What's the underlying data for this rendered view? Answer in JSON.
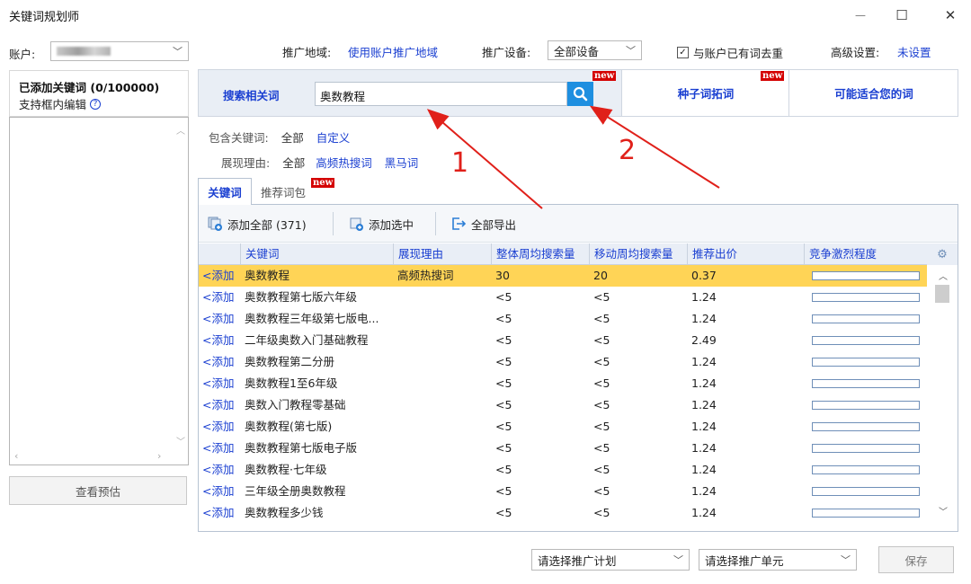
{
  "window": {
    "title": "关键词规划师",
    "minimize_glyph": "—",
    "maximize_glyph": "☐",
    "close_glyph": "✕"
  },
  "top_settings": {
    "account_label": "账户:",
    "region_label": "推广地域:",
    "region_value": "使用账户推广地域",
    "device_label": "推广设备:",
    "device_value": "全部设备",
    "dedupe_label": "与账户已有词去重",
    "dedupe_checked": true,
    "advanced_label": "高级设置:",
    "advanced_value": "未设置"
  },
  "left_pane": {
    "header_title": "已添加关键词 (0/100000)",
    "header_sub": "支持框内编辑",
    "preview_button": "查看预估"
  },
  "search": {
    "tab_label": "搜索相关词",
    "query": "奥数教程",
    "new_badge": "new"
  },
  "main_tabs": [
    {
      "label": "种子词拓词",
      "new_badge": "new"
    },
    {
      "label": "可能适合您的词"
    }
  ],
  "filters": {
    "contains_label": "包含关键词:",
    "contains_all": "全部",
    "contains_custom": "自定义",
    "reason_label": "展现理由:",
    "reason_all": "全部",
    "reason_hot": "高频热搜词",
    "reason_dark": "黑马词"
  },
  "sub_tabs": [
    {
      "label": "关键词",
      "active": true
    },
    {
      "label": "推荐词包",
      "new_badge": "new"
    }
  ],
  "toolbar": {
    "add_all": "添加全部 (371)",
    "add_selected": "添加选中",
    "export_all": "全部导出"
  },
  "table": {
    "columns": [
      "关键词",
      "展现理由",
      "整体周均搜索量",
      "移动周均搜索量",
      "推荐出价",
      "竞争激烈程度"
    ],
    "add_label": "<添加",
    "rows": [
      {
        "keyword": "奥数教程",
        "reason": "高频热搜词",
        "total": "30",
        "mobile": "20",
        "bid": "0.37",
        "competition": 0.0,
        "selected": true
      },
      {
        "keyword": "奥数教程第七版六年级",
        "reason": "",
        "total": "<5",
        "mobile": "<5",
        "bid": "1.24",
        "competition": 0.0
      },
      {
        "keyword": "奥数教程三年级第七版电...",
        "reason": "",
        "total": "<5",
        "mobile": "<5",
        "bid": "1.24",
        "competition": 0.0
      },
      {
        "keyword": "二年级奥数入门基础教程",
        "reason": "",
        "total": "<5",
        "mobile": "<5",
        "bid": "2.49",
        "competition": 0.0
      },
      {
        "keyword": "奥数教程第二分册",
        "reason": "",
        "total": "<5",
        "mobile": "<5",
        "bid": "1.24",
        "competition": 0.0
      },
      {
        "keyword": "奥数教程1至6年级",
        "reason": "",
        "total": "<5",
        "mobile": "<5",
        "bid": "1.24",
        "competition": 0.0
      },
      {
        "keyword": "奥数入门教程零基础",
        "reason": "",
        "total": "<5",
        "mobile": "<5",
        "bid": "1.24",
        "competition": 0.0
      },
      {
        "keyword": "奥数教程(第七版)",
        "reason": "",
        "total": "<5",
        "mobile": "<5",
        "bid": "1.24",
        "competition": 0.0
      },
      {
        "keyword": "奥数教程第七版电子版",
        "reason": "",
        "total": "<5",
        "mobile": "<5",
        "bid": "1.24",
        "competition": 0.0
      },
      {
        "keyword": "奥数教程·七年级",
        "reason": "",
        "total": "<5",
        "mobile": "<5",
        "bid": "1.24",
        "competition": 0.0
      },
      {
        "keyword": "三年级全册奥数教程",
        "reason": "",
        "total": "<5",
        "mobile": "<5",
        "bid": "1.24",
        "competition": 0.0
      },
      {
        "keyword": "奥数教程多少钱",
        "reason": "",
        "total": "<5",
        "mobile": "<5",
        "bid": "1.24",
        "competition": 0.0
      }
    ]
  },
  "bottom": {
    "plan_select": "请选择推广计划",
    "unit_select": "请选择推广单元",
    "save": "保存"
  },
  "annotations": [
    "1",
    "2"
  ],
  "colors": {
    "link": "#1a3fd1",
    "selected_row": "#ffd456",
    "search_button": "#1e8fe0",
    "annotation": "#e0201a",
    "badge": "#d40000"
  }
}
